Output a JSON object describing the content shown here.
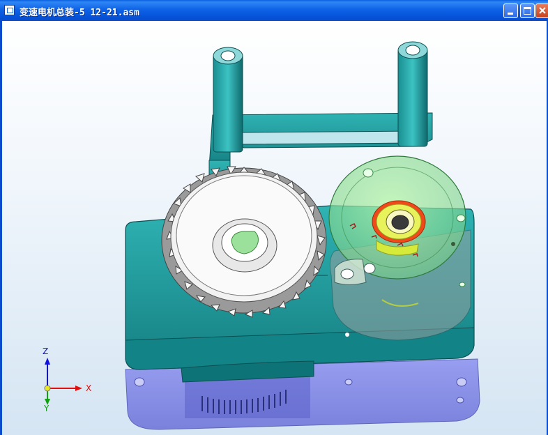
{
  "window": {
    "title": "变速电机总装-5 12-21.asm"
  },
  "title_buttons": {
    "minimize": "minimize-icon",
    "maximize": "maximize-icon",
    "close": "close-icon"
  },
  "triad": {
    "z_label": "Z",
    "x_label": "X",
    "y_label": "Y"
  },
  "colors": {
    "titlebar": "#0a5fe0",
    "housing": "#1a9a9a",
    "cover_purple": "#7b82e6",
    "gear_white": "#f0f0f0",
    "green_cover": "#6fe06f",
    "axis_x": "#e01010",
    "axis_z": "#1010e0",
    "axis_y": "#10a010"
  }
}
